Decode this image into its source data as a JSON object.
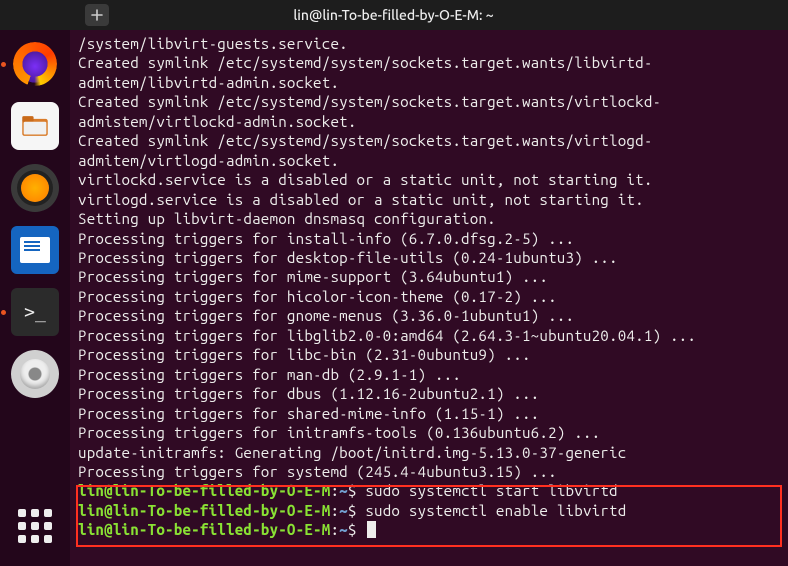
{
  "window": {
    "title": "lin@lin-To-be-filled-by-O-E-M: ~"
  },
  "dock": {
    "items": [
      {
        "name": "firefox-icon"
      },
      {
        "name": "files-icon"
      },
      {
        "name": "rhythmbox-icon"
      },
      {
        "name": "writer-icon"
      },
      {
        "name": "terminal-icon"
      },
      {
        "name": "disks-icon"
      }
    ],
    "apps_label": "Show Applications"
  },
  "terminal": {
    "lines": [
      "/system/libvirt-guests.service.",
      "Created symlink /etc/systemd/system/sockets.target.wants/libvirtd-admitem/libvirtd-admin.socket.",
      "Created symlink /etc/systemd/system/sockets.target.wants/virtlockd-admistem/virtlockd-admin.socket.",
      "Created symlink /etc/systemd/system/sockets.target.wants/virtlogd-admitem/virtlogd-admin.socket.",
      "virtlockd.service is a disabled or a static unit, not starting it.",
      "virtlogd.service is a disabled or a static unit, not starting it.",
      "Setting up libvirt-daemon dnsmasq configuration.",
      "Processing triggers for install-info (6.7.0.dfsg.2-5) ...",
      "Processing triggers for desktop-file-utils (0.24-1ubuntu3) ...",
      "Processing triggers for mime-support (3.64ubuntu1) ...",
      "Processing triggers for hicolor-icon-theme (0.17-2) ...",
      "Processing triggers for gnome-menus (3.36.0-1ubuntu1) ...",
      "Processing triggers for libglib2.0-0:amd64 (2.64.3-1~ubuntu20.04.1) ...",
      "Processing triggers for libc-bin (2.31-0ubuntu9) ...",
      "Processing triggers for man-db (2.9.1-1) ...",
      "Processing triggers for dbus (1.12.16-2ubuntu2.1) ...",
      "Processing triggers for shared-mime-info (1.15-1) ...",
      "Processing triggers for initramfs-tools (0.136ubuntu6.2) ...",
      "update-initramfs: Generating /boot/initrd.img-5.13.0-37-generic",
      "Processing triggers for systemd (245.4-4ubuntu3.15) ..."
    ],
    "prompts": [
      {
        "user": "lin@lin-To-be-filled-by-O-E-M",
        "path": "~",
        "cmd": "sudo systemctl start libvirtd"
      },
      {
        "user": "lin@lin-To-be-filled-by-O-E-M",
        "path": "~",
        "cmd": "sudo systemctl enable libvirtd"
      },
      {
        "user": "lin@lin-To-be-filled-by-O-E-M",
        "path": "~",
        "cmd": ""
      }
    ]
  }
}
